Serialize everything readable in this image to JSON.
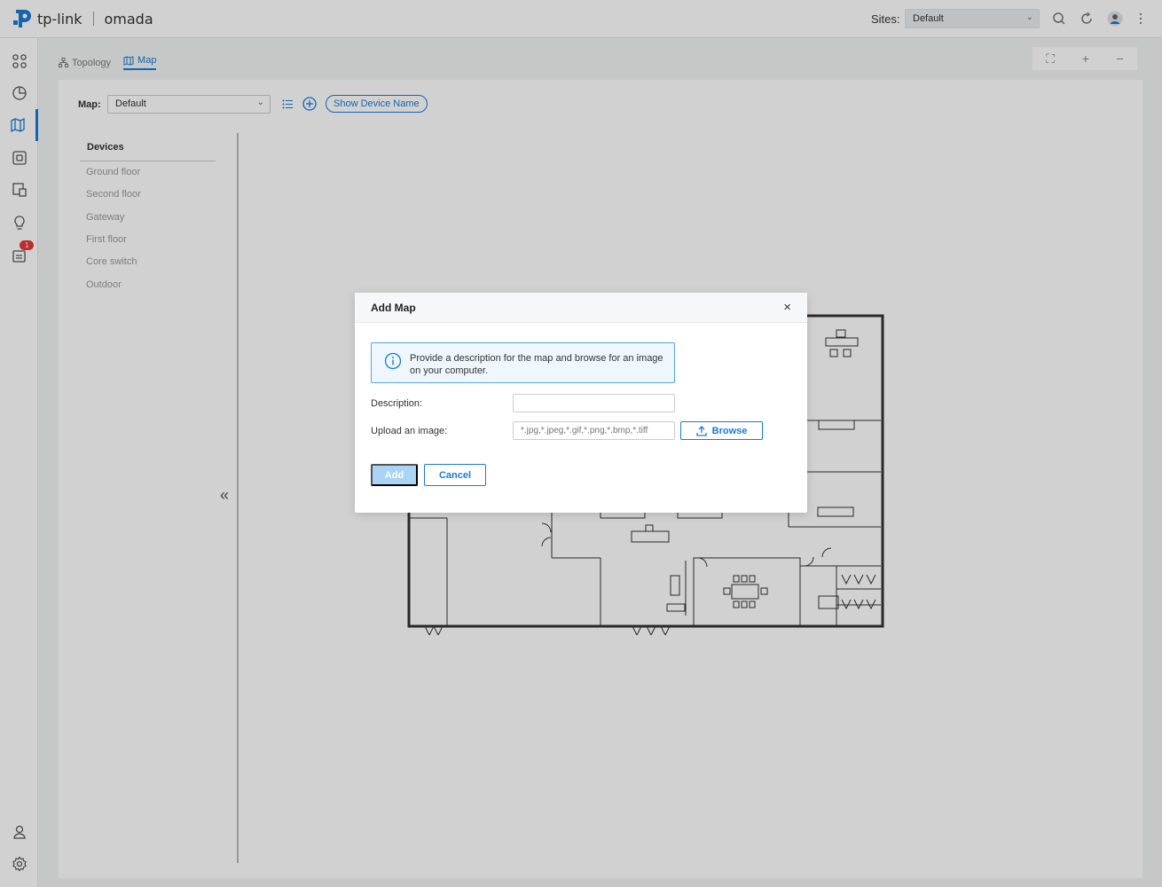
{
  "topbar": {
    "brand": "tp-link",
    "product": "omada",
    "sites_label": "Sites:",
    "sites_value": "Default",
    "icons": [
      "search-icon",
      "refresh-icon",
      "user-avatar-icon",
      "more-vertical-icon"
    ]
  },
  "sidebar": {
    "items": [
      {
        "name": "dashboard-icon"
      },
      {
        "name": "statistics-icon"
      },
      {
        "name": "map-icon"
      },
      {
        "name": "devices-icon"
      },
      {
        "name": "clients-icon"
      },
      {
        "name": "insight-icon"
      },
      {
        "name": "logs-icon",
        "badge": "1"
      }
    ],
    "bottom": [
      {
        "name": "account-icon"
      },
      {
        "name": "settings-icon"
      }
    ]
  },
  "breadcrumb": {
    "topology": "Topology",
    "map": "Map"
  },
  "zoom": {
    "fullscreen": "⛶",
    "plus": "+",
    "minus": "−"
  },
  "toolbar": {
    "map_label": "Map:",
    "map_value": "Default",
    "show_device_name": "Show Device Name"
  },
  "devices": {
    "title": "Devices",
    "items": [
      "Ground floor",
      "Second floor",
      "Gateway",
      "First floor",
      "Core switch",
      "Outdoor"
    ]
  },
  "modal": {
    "title": "Add Map",
    "close": "×",
    "info": "Provide a description for the map and browse for an image on your computer.",
    "description_label": "Description:",
    "description_value": "",
    "upload_label": "Upload an image:",
    "upload_placeholder": "*.jpg,*.jpeg,*.gif,*.png,*.bmp,*.tiff",
    "browse": "Browse",
    "add": "Add",
    "cancel": "Cancel"
  },
  "colors": {
    "accent": "#1a7ad8",
    "badge": "#e53935",
    "add_disabled": "#a9d4f5"
  }
}
